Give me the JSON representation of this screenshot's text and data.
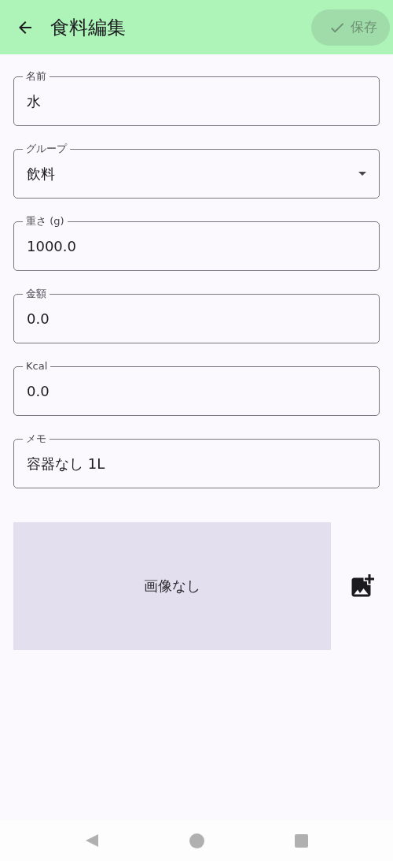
{
  "app_bar": {
    "title": "食料編集",
    "save_button": {
      "label": "保存",
      "disabled": true
    }
  },
  "fields": [
    {
      "kind": "text",
      "label": "名前",
      "value": "水"
    },
    {
      "kind": "dropdown",
      "label": "グループ",
      "value": "飲料"
    },
    {
      "kind": "text",
      "label": "重さ (g)",
      "value": "1000.0"
    },
    {
      "kind": "text",
      "label": "金額",
      "value": "0.0"
    },
    {
      "kind": "text",
      "label": "Kcal",
      "value": "0.0"
    },
    {
      "kind": "text",
      "label": "メモ",
      "value": "容器なし 1L"
    }
  ],
  "image": {
    "placeholder": "画像なし"
  }
}
